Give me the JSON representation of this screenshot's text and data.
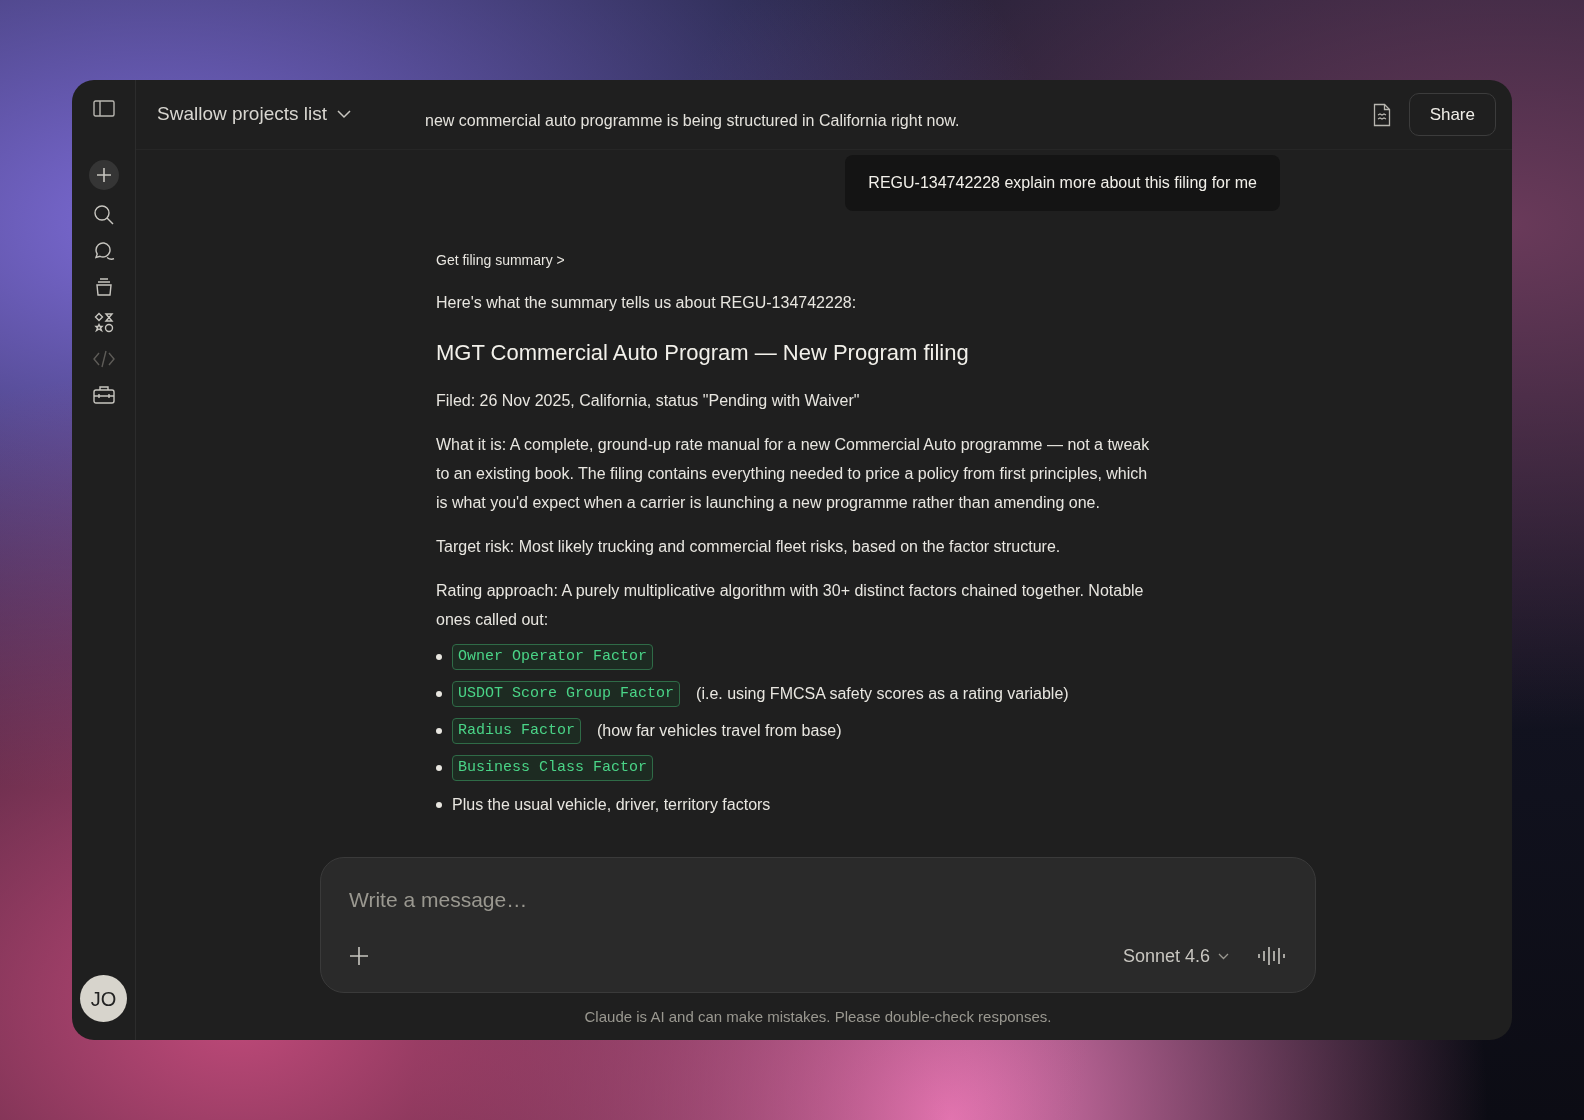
{
  "sidebar": {
    "items": [
      {
        "kind": "new_chat",
        "disabled": false
      },
      {
        "kind": "search",
        "disabled": false
      },
      {
        "kind": "chats",
        "disabled": false
      },
      {
        "kind": "projects",
        "disabled": false
      },
      {
        "kind": "artifacts",
        "disabled": false
      },
      {
        "kind": "code",
        "disabled": true
      },
      {
        "kind": "toolbox",
        "disabled": false
      }
    ],
    "avatar": "JO"
  },
  "header": {
    "project_title": "Swallow projects list",
    "share_button": "Share"
  },
  "conversation": {
    "previous_text": "new commercial auto programme is being structured in California right now.",
    "user_message": "REGU-134742228 explain more about this filing for me",
    "tool_call": "Get filing summary >",
    "blocks": [
      {
        "kind": "paragraph",
        "text": "Here's what the summary tells us about REGU-134742228:"
      },
      {
        "kind": "heading",
        "text": "MGT Commercial Auto Program — New Program filing"
      },
      {
        "kind": "paragraph",
        "text": "Filed: 26 Nov 2025, California, status \"Pending with Waiver\""
      },
      {
        "kind": "paragraph",
        "text": "What it is: A complete, ground-up rate manual for a new Commercial Auto programme — not a tweak to an existing book. The filing contains everything needed to price a policy from first principles, which is what you'd expect when a carrier is launching a new programme rather than amending one."
      },
      {
        "kind": "paragraph",
        "text": "Target risk: Most likely trucking and commercial fleet risks, based on the factor structure."
      },
      {
        "kind": "paragraph",
        "text": "Rating approach: A purely multiplicative algorithm with 30+ distinct factors chained together. Notable ones called out:"
      },
      {
        "kind": "list",
        "items": [
          {
            "kind": "code",
            "code": "Owner Operator Factor"
          },
          {
            "kind": "code",
            "code": "USDOT Score Group Factor",
            "note": "(i.e. using FMCSA safety scores as a rating variable)"
          },
          {
            "kind": "code",
            "code": "Radius Factor",
            "note": "(how far vehicles travel from base)"
          },
          {
            "kind": "code",
            "code": "Business Class Factor"
          },
          {
            "kind": "text",
            "text": "Plus the usual vehicle, driver, territory factors"
          }
        ]
      }
    ]
  },
  "composer": {
    "placeholder": "Write a message…",
    "model": "Sonnet 4.6"
  },
  "disclaimer": "Claude is AI and can make mistakes. Please double-check responses."
}
